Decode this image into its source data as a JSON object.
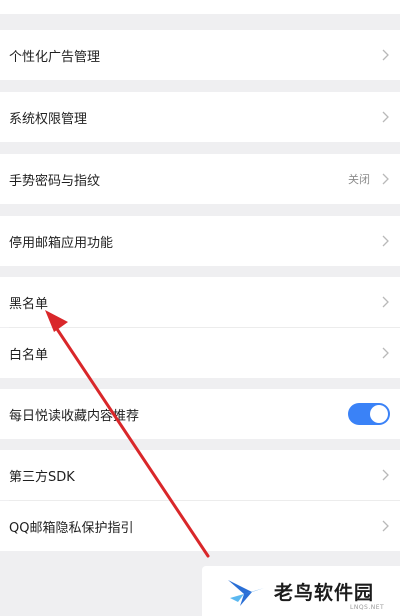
{
  "settings": {
    "rows": [
      {
        "label": "个性化广告管理"
      },
      {
        "label": "系统权限管理"
      },
      {
        "label": "手势密码与指纹",
        "value": "关闭"
      },
      {
        "label": "停用邮箱应用功能"
      },
      {
        "label": "黑名单"
      },
      {
        "label": "白名单"
      },
      {
        "label": "每日悦读收藏内容推荐",
        "toggle": true
      },
      {
        "label": "第三方SDK"
      },
      {
        "label": "QQ邮箱隐私保护指引"
      }
    ]
  },
  "watermark": {
    "text": "老鸟软件园",
    "sub": "LNQS.NET"
  },
  "colors": {
    "toggle_on": "#3a82f7",
    "arrow": "#d9272a"
  }
}
